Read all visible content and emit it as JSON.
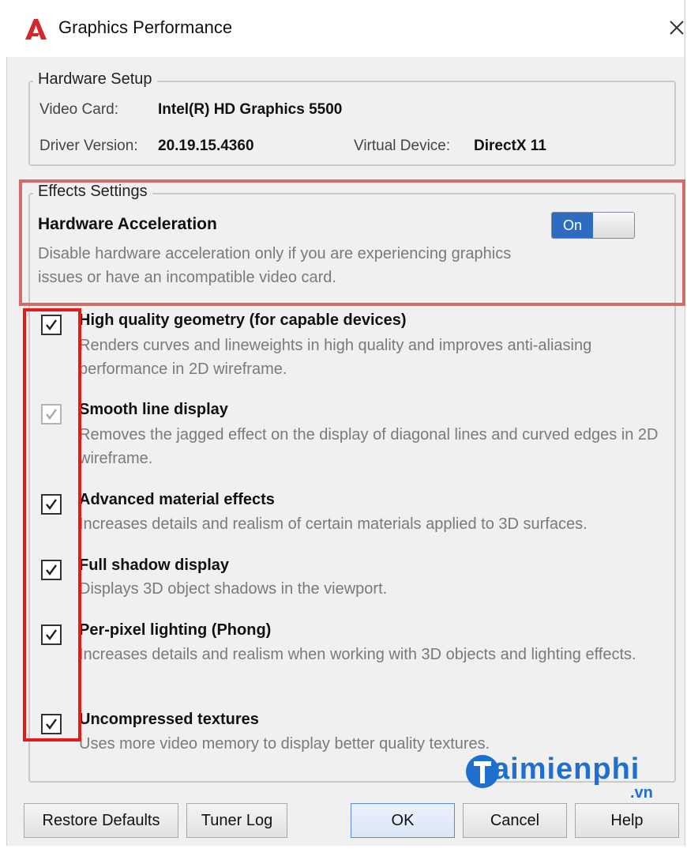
{
  "window": {
    "title": "Graphics Performance"
  },
  "hardware_setup": {
    "group_title": "Hardware Setup",
    "video_card_label": "Video Card:",
    "video_card_value": "Intel(R) HD Graphics 5500",
    "driver_label": "Driver Version:",
    "driver_value": "20.19.15.4360",
    "virtual_device_label": "Virtual Device:",
    "virtual_device_value": "DirectX 11"
  },
  "effects": {
    "group_title": "Effects Settings",
    "hardware_acceleration_title": "Hardware Acceleration",
    "hardware_acceleration_desc": "Disable hardware acceleration only if you are experiencing graphics issues or have an incompatible video card.",
    "toggle_label": "On",
    "toggle_state": "on"
  },
  "options": [
    {
      "title": "High quality geometry (for capable devices)",
      "desc": "Renders curves and lineweights in high quality and improves anti-aliasing performance in 2D wireframe.",
      "checked": true,
      "enabled": true
    },
    {
      "title": "Smooth line display",
      "desc": "Removes the jagged effect on the display of diagonal lines and curved edges in 2D wireframe.",
      "checked": true,
      "enabled": false
    },
    {
      "title": "Advanced material effects",
      "desc": "Increases details and realism of certain materials applied to 3D surfaces.",
      "checked": true,
      "enabled": true
    },
    {
      "title": "Full shadow display",
      "desc": "Displays 3D object shadows in the viewport.",
      "checked": true,
      "enabled": true
    },
    {
      "title": "Per-pixel lighting (Phong)",
      "desc": "Increases details and realism when working with 3D objects and lighting effects.",
      "checked": true,
      "enabled": true
    },
    {
      "title": "Uncompressed textures",
      "desc": "Uses more video memory to display better quality textures.",
      "checked": true,
      "enabled": true
    }
  ],
  "buttons": {
    "restore_defaults": "Restore Defaults",
    "tuner_log": "Tuner Log",
    "ok": "OK",
    "cancel": "Cancel",
    "help": "Help"
  },
  "watermark": {
    "text": "aimienphi",
    "suffix": ".vn"
  },
  "colors": {
    "accent": "#2d6cc0",
    "highlight_red": "#e21b1b",
    "brand_red": "#d6262b"
  },
  "icons": {
    "app": "autocad-a-icon",
    "close": "close-icon",
    "check": "checkmark-icon"
  }
}
